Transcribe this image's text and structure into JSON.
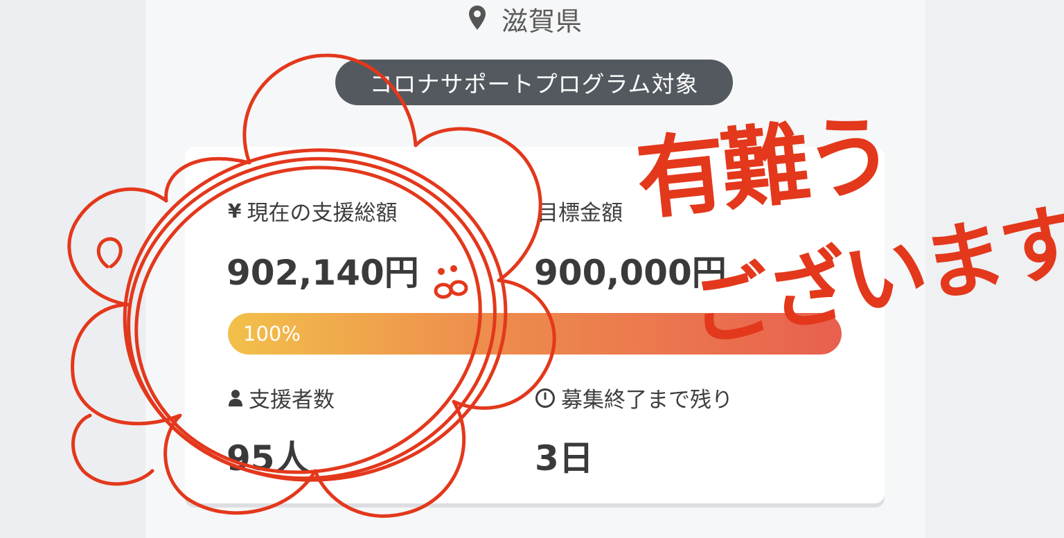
{
  "location": {
    "icon": "map-pin-icon",
    "name": "滋賀県"
  },
  "program_badge": "コロナサポートプログラム対象",
  "stats": {
    "current": {
      "icon": "yen-icon",
      "icon_glyph": "¥",
      "label": "現在の支援総額",
      "value": "902,140円"
    },
    "target": {
      "label": "目標金額",
      "value": "900,000円"
    },
    "supporters": {
      "icon": "person-icon",
      "label": "支援者数",
      "value": "95人"
    },
    "remaining": {
      "icon": "clock-icon",
      "label": "募集終了まで残り",
      "value": "3日"
    }
  },
  "progress": {
    "percent_label": "100%",
    "fill_fraction": 1.0
  },
  "handwriting": {
    "line1": "有難う",
    "line2": "ございます!",
    "color": "#e3381c"
  },
  "colors": {
    "badge_bg": "#545960",
    "progress_start": "#f2c04a",
    "progress_end": "#e8604e",
    "ink": "#e3381c"
  }
}
